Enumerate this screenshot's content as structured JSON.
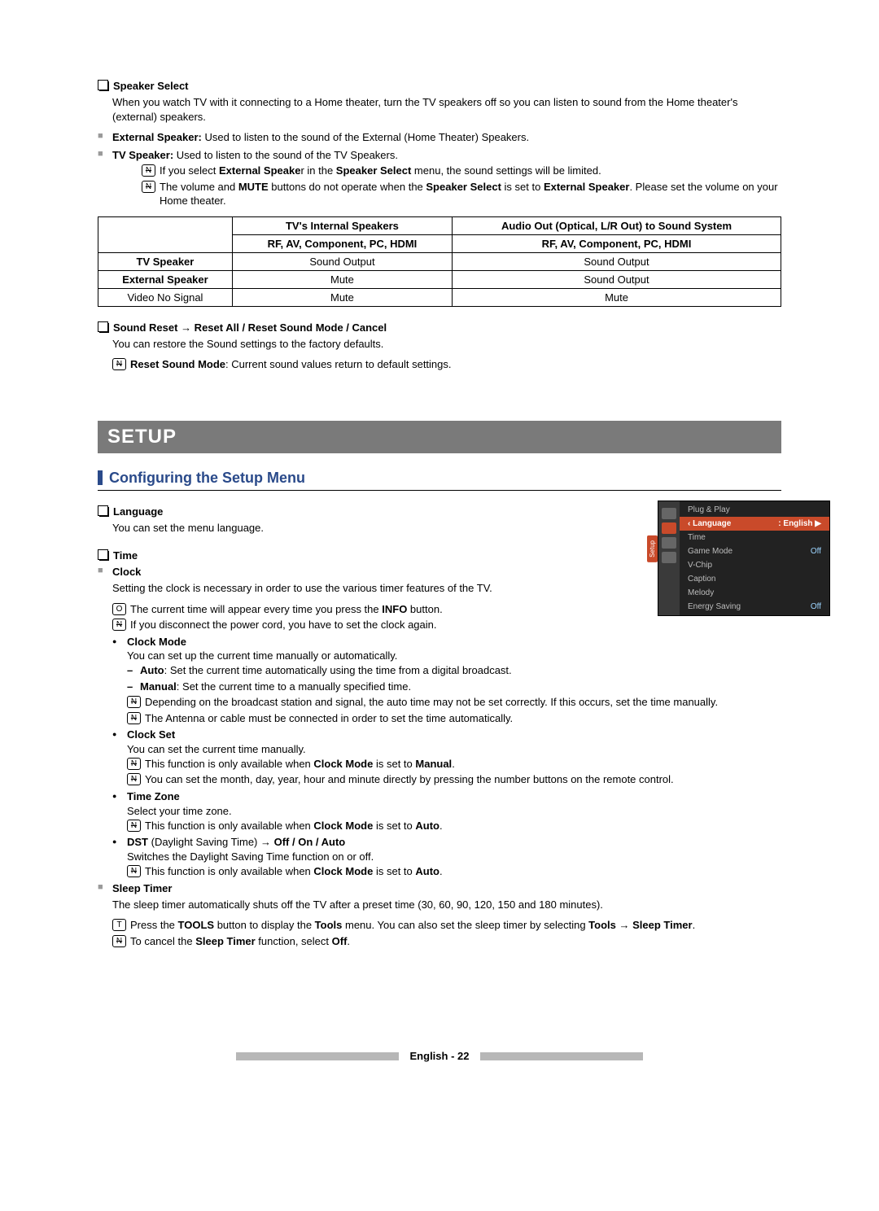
{
  "speakerSelect": {
    "title": "Speaker Select",
    "desc": "When you watch TV with it connecting to a Home theater, turn the TV speakers off so you can listen to sound from the Home theater's (external) speakers.",
    "ext_label": "External Speaker:",
    "ext_text": " Used to listen to the sound of the External (Home Theater) Speakers.",
    "tv_label": "TV Speaker:",
    "tv_text": " Used to listen to the sound of the TV Speakers.",
    "note1_pre": "If you select ",
    "note1_b1": "External Speake",
    "note1_mid": "r in the ",
    "note1_b2": "Speaker Select",
    "note1_post": " menu, the sound settings will be limited.",
    "note2_a": "The volume and ",
    "note2_b1": "MUTE",
    "note2_b": " buttons do not operate when the ",
    "note2_b2": "Speaker Select",
    "note2_c": " is set to ",
    "note2_b3": "External Speaker",
    "note2_d": ". Please set the volume on your Home theater."
  },
  "table": {
    "h1": "TV's Internal Speakers",
    "h2": "Audio Out (Optical, L/R Out) to Sound System",
    "sub": "RF, AV, Component, PC, HDMI",
    "r1": "TV Speaker",
    "r1c1": "Sound Output",
    "r1c2": "Sound Output",
    "r2": "External Speaker",
    "r2c1": "Mute",
    "r2c2": "Sound Output",
    "r3": "Video No Signal",
    "r3c1": "Mute",
    "r3c2": "Mute"
  },
  "soundReset": {
    "title": "Sound Reset → Reset All / Reset Sound Mode / Cancel",
    "desc": "You can restore the Sound settings to the factory defaults.",
    "note_b": "Reset Sound Mode",
    "note_t": ": Current sound values return to default settings."
  },
  "setupBar": "SETUP",
  "configHeading": "Configuring the Setup Menu",
  "language": {
    "title": "Language",
    "desc": "You can set the menu language."
  },
  "time": {
    "title": "Time",
    "clock_label": "Clock",
    "clock_desc": "Setting the clock is necessary in order to use the various timer features of the TV.",
    "clock_o_a": "The current time will appear every time you press the ",
    "clock_o_b": "INFO",
    "clock_o_c": " button.",
    "clock_n": "If you disconnect the power cord, you have to set the clock again.",
    "clockmode_label": "Clock Mode",
    "clockmode_desc": "You can set up the current time manually or automatically.",
    "auto_b": "Auto",
    "auto_t": ": Set the current time automatically using the time from a digital broadcast.",
    "manual_b": "Manual",
    "manual_t": ": Set the current time to a manually specified time.",
    "cm_n1": "Depending on the broadcast station and signal, the auto time may not be set correctly. If this occurs, set the time manually.",
    "cm_n2": "The Antenna or cable must be connected in order to set the time automatically.",
    "clockset_label": "Clock Set",
    "clockset_desc": "You can set the current time manually.",
    "cs_n1_a": "This function is only available when ",
    "cs_n1_b": "Clock Mode",
    "cs_n1_c": " is set to ",
    "cs_n1_d": "Manual",
    "cs_n1_e": ".",
    "cs_n2": "You can set the month, day, year, hour and minute directly by pressing the number buttons on the remote control.",
    "tz_label": "Time Zone",
    "tz_desc": "Select your time zone.",
    "tz_n_a": "This function is only available when ",
    "tz_n_b": "Clock Mode",
    "tz_n_c": " is set to ",
    "tz_n_d": "Auto",
    "tz_n_e": ".",
    "dst_b": "DST",
    "dst_t": " (Daylight Saving Time) → ",
    "dst_opts": "Off / On / Auto",
    "dst_desc": "Switches the Daylight Saving Time function on or off.",
    "dst_n_a": "This function is only available when ",
    "dst_n_b": "Clock Mode",
    "dst_n_c": " is set to ",
    "dst_n_d": "Auto",
    "dst_n_e": ".",
    "sleep_label": "Sleep Timer",
    "sleep_desc": "The sleep timer automatically shuts off the TV after a preset time (30, 60, 90, 120, 150 and 180 minutes).",
    "sleep_t_a": "Press the ",
    "sleep_t_b": "TOOLS",
    "sleep_t_c": " button to display the ",
    "sleep_t_d": "Tools",
    "sleep_t_e": " menu. You can also set the sleep timer by selecting ",
    "sleep_t_f": "Tools → Sleep Timer",
    "sleep_t_g": ".",
    "sleep_n_a": "To cancel the ",
    "sleep_n_b": "Sleep Timer",
    "sleep_n_c": " function, select ",
    "sleep_n_d": "Off",
    "sleep_n_e": "."
  },
  "osd": {
    "sidelabel": "Setup",
    "items": [
      {
        "label": "Plug & Play",
        "val": ""
      },
      {
        "label": "Language",
        "val": ": English",
        "sel": true
      },
      {
        "label": "Time",
        "val": ""
      },
      {
        "label": "Game Mode",
        "val": "Off"
      },
      {
        "label": "V-Chip",
        "val": ""
      },
      {
        "label": "Caption",
        "val": ""
      },
      {
        "label": "Melody",
        "val": ""
      },
      {
        "label": "Energy Saving",
        "val": "Off"
      }
    ]
  },
  "footer": {
    "lang": "English - ",
    "page": "22"
  }
}
